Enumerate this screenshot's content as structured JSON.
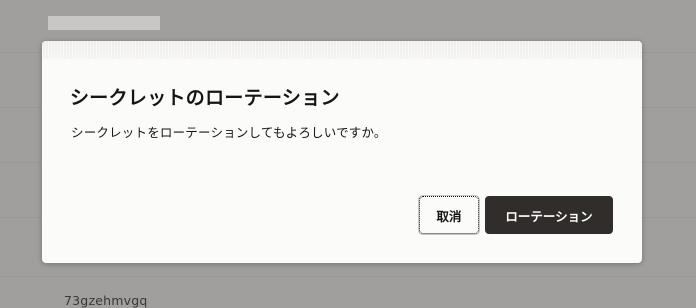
{
  "background": {
    "row_text": "73gzehmvgq"
  },
  "dialog": {
    "title": "シークレットのローテーション",
    "message": "シークレットをローテーションしてもよろしいですか。",
    "cancel_label": "取消",
    "confirm_label": "ローテーション"
  },
  "colors": {
    "overlay": "#a19f9e",
    "dialog_bg": "#fbfbfa",
    "text": "#161513",
    "primary_button": "#312d2a",
    "primary_button_text": "#ffffff"
  }
}
